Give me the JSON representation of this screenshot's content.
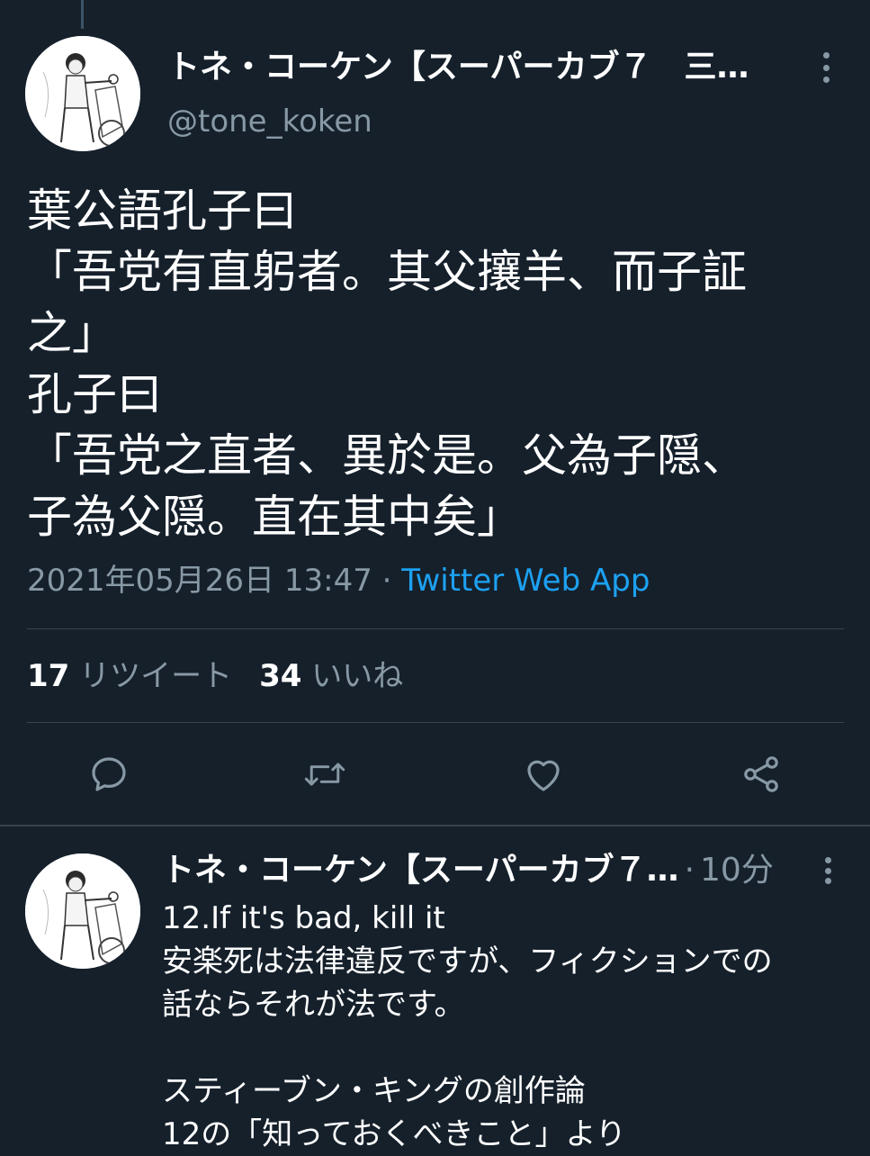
{
  "main_tweet": {
    "display_name": "トネ・コーケン【スーパーカブ７　三…",
    "handle": "@tone_koken",
    "body_lines": [
      "葉公語孔子曰",
      "「吾党有直躬者。其父攘羊、而子証",
      "之」",
      "孔子曰",
      "「吾党之直者、異於是。父為子隠、",
      "子為父隠。直在其中矣」"
    ],
    "timestamp": "2021年05月26日 13:47",
    "separator": " · ",
    "source": "Twitter Web App",
    "retweet_count": "17",
    "retweet_label": "リツイート",
    "like_count": "34",
    "like_label": "いいね",
    "actions": [
      {
        "icon": "reply-icon"
      },
      {
        "icon": "retweet-icon"
      },
      {
        "icon": "like-icon"
      },
      {
        "icon": "share-icon"
      }
    ]
  },
  "reply_tweet": {
    "display_name": "トネ・コーケン【スーパーカブ７…",
    "separator": "·",
    "time": "10分",
    "body_lines": [
      "12.If it's bad, kill it",
      "安楽死は法律違反ですが、フィクションでの",
      "話ならそれが法です。",
      "",
      "スティーブン・キングの創作論",
      "12の「知っておくべきこと」より"
    ]
  },
  "colors": {
    "background": "#15202b",
    "text_primary": "#ffffff",
    "text_secondary": "#8899a6",
    "accent": "#1da1f2",
    "divider": "#38444d"
  }
}
